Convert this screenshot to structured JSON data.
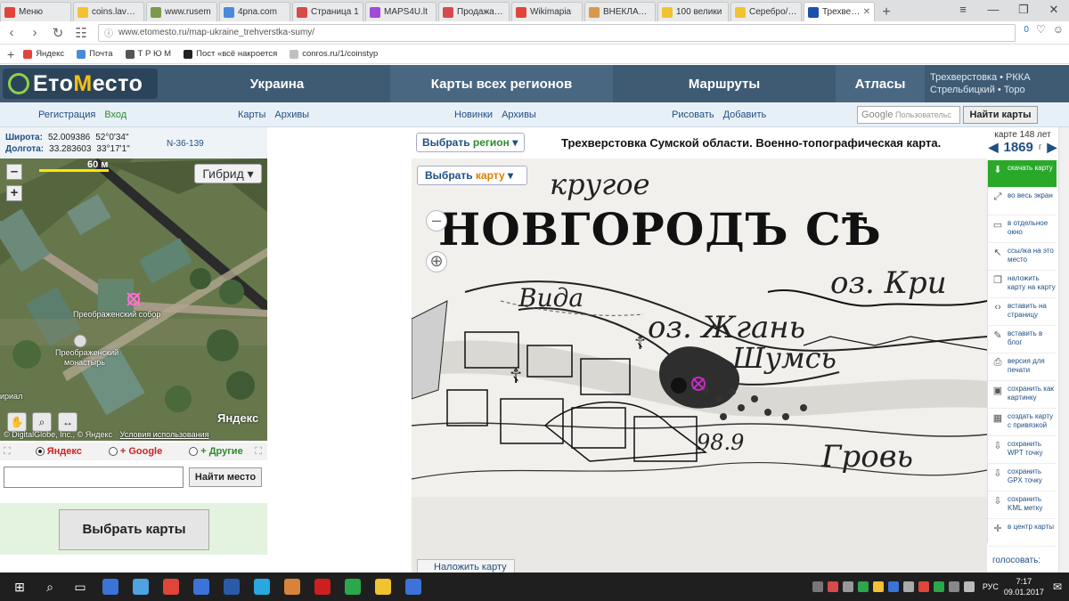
{
  "browser": {
    "tabs": [
      {
        "label": "Меню",
        "color": "#e0453a"
      },
      {
        "label": "coins.lave.ru",
        "color": "#f2c230"
      },
      {
        "label": "www.rusem",
        "color": "#7a9a4a"
      },
      {
        "label": "4pna.com",
        "color": "#4a8ad8"
      },
      {
        "label": "Страница 1",
        "color": "#d84a4a"
      },
      {
        "label": "MAPS4U.lt",
        "color": "#a04ad8"
      },
      {
        "label": "Продажа тр",
        "color": "#d84a4a"
      },
      {
        "label": "Wikimapia",
        "color": "#e0453a"
      },
      {
        "label": "ВНЕКЛАССН",
        "color": "#d89a4a"
      },
      {
        "label": "100 велики",
        "color": "#f2c230"
      },
      {
        "label": "Серебро/Зо",
        "color": "#f2c230"
      },
      {
        "label": "Трехверсто",
        "color": "#1d4fae",
        "active": true
      }
    ],
    "new_tab": "+",
    "window_controls": {
      "menu": "≡",
      "minimize": "—",
      "maximize": "❐",
      "close": "✕"
    },
    "url": "www.etomesto.ru/map-ukraine_trehverstka-sumy/",
    "url_badge": "0",
    "bookmarks": [
      {
        "label": "Яндекс",
        "color": "#e0453a"
      },
      {
        "label": "Почта",
        "color": "#4a8ad8"
      },
      {
        "label": "Т Р Ю М",
        "color": "#555555"
      },
      {
        "label": "Пост «всё накроется",
        "color": "#222222"
      },
      {
        "label": "conros.ru/1/coinstyp",
        "color": "#c0c0c0"
      }
    ]
  },
  "site": {
    "logo": {
      "a": "Ето",
      "b": "М",
      "c": "есто"
    },
    "nav": [
      {
        "label": "Украина"
      },
      {
        "label": "Карты всех регионов"
      },
      {
        "label": "Маршруты"
      },
      {
        "label": "Атласы"
      }
    ],
    "atlas_sub": [
      "Трехверстовка • РККА",
      "Стрельбицкий • Topo"
    ],
    "sub": {
      "register": "Регистрация",
      "login": "Вход",
      "maps": "Карты",
      "archives": "Архивы",
      "news": "Новинки",
      "archives2": "Архивы",
      "draw": "Рисовать",
      "add": "Добавить",
      "google_placeholder": "Пользовательс",
      "google_logo": "Google",
      "find_maps": "Найти карты"
    }
  },
  "left": {
    "lat_label": "Широта:",
    "lat_dec": "52.009386",
    "lat_dms": "52°0'34\"",
    "lon_label": "Долгота:",
    "lon_dec": "33.283603",
    "lon_dms": "33°17'1\"",
    "sheet": "N-36-139",
    "scale": "60 м",
    "mode": "Гибрид ▾",
    "labels": {
      "cathedral": "Преображенский собор",
      "monastery1": "Преображенский",
      "monastery2": "монастырь",
      "edge": "ириал"
    },
    "copyright": "© DigitalGlobe, Inc., © Яндекс",
    "terms": "Условия использования",
    "brand": "Яндекс",
    "sources": [
      {
        "label": "Яндекс",
        "selected": true
      },
      {
        "label": "+ Google",
        "selected": false
      },
      {
        "label": "+ Другие",
        "selected": false
      }
    ],
    "find_place": "Найти место",
    "choose_maps": "Выбрать карты"
  },
  "map": {
    "select_region_a": "Выбрать ",
    "select_region_b": "регион",
    "select_map_a": "Выбрать ",
    "select_map_b": "карту",
    "title": "Трехверстовка Сумской области. Военно-топографическая карта.",
    "year_label": "карте 148 лет",
    "year": "1869",
    "year_suffix": "г",
    "overlay": "Наложить карту",
    "texts": {
      "t1": "НОВГОРОДЪ СѢ",
      "t2": "Вида",
      "t3": "оз. Жгань",
      "t4": "оз. Кри",
      "t5": "Шумсь",
      "t6": "Гровь",
      "t7": "кругое",
      "t8": "98.9"
    }
  },
  "actions": [
    {
      "label": "скачать карту",
      "icon": "⬇"
    },
    {
      "label": "во весь экран",
      "icon": "⤢"
    },
    {
      "label": "в отдельное окно",
      "icon": "▭"
    },
    {
      "label": "ссылка на это место",
      "icon": "↖"
    },
    {
      "label": "наложить карту на карту",
      "icon": "❐"
    },
    {
      "label": "вставить на страницу",
      "icon": "‹›"
    },
    {
      "label": "вставить в блог",
      "icon": "✎"
    },
    {
      "label": "версия для печати",
      "icon": "⎙"
    },
    {
      "label": "сохранить как картинку",
      "icon": "▣"
    },
    {
      "label": "создать карту с привязкой",
      "icon": "▦"
    },
    {
      "label": "сохранить WPT точку",
      "icon": "⇩"
    },
    {
      "label": "сохранить GPX точку",
      "icon": "⇩"
    },
    {
      "label": "сохранить KML метку",
      "icon": "⇩"
    },
    {
      "label": "в центр карты",
      "icon": "✛"
    }
  ],
  "vote": "голосовать:",
  "taskbar": {
    "lang": "РУС",
    "time": "7:17",
    "date": "09.01.2017",
    "apps": [
      "#3b73d8",
      "#4fa3e0",
      "#e0453a",
      "#3b73d8",
      "#2b5aa8",
      "#29a8e0",
      "#d8833b",
      "#cc1f1f",
      "#2aa84a",
      "#f2c230",
      "#3b73d8"
    ]
  }
}
